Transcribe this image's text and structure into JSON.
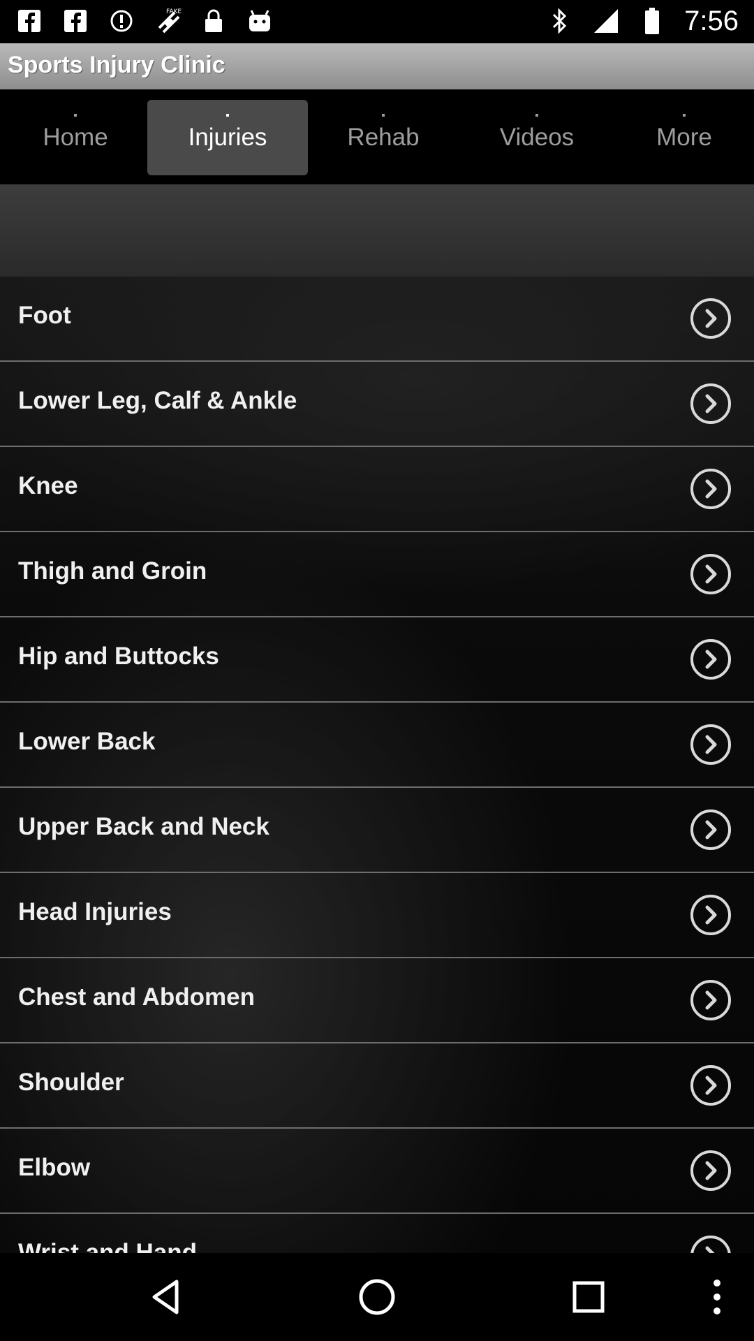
{
  "status_bar": {
    "time": "7:56",
    "icons": [
      "facebook-icon",
      "facebook-icon",
      "alert-circle-icon",
      "fake-gps-icon",
      "lock-icon",
      "android-icon",
      "bluetooth-icon",
      "signal-icon",
      "battery-icon"
    ]
  },
  "app": {
    "title": "Sports Injury Clinic"
  },
  "tabs": [
    {
      "label": "Home",
      "active": false
    },
    {
      "label": "Injuries",
      "active": true
    },
    {
      "label": "Rehab",
      "active": false
    },
    {
      "label": "Videos",
      "active": false
    },
    {
      "label": "More",
      "active": false
    }
  ],
  "injury_list": [
    {
      "label": "Foot"
    },
    {
      "label": "Lower Leg, Calf & Ankle"
    },
    {
      "label": "Knee"
    },
    {
      "label": "Thigh and Groin"
    },
    {
      "label": "Hip and Buttocks"
    },
    {
      "label": "Lower Back"
    },
    {
      "label": "Upper Back and Neck"
    },
    {
      "label": "Head Injuries"
    },
    {
      "label": "Chest and Abdomen"
    },
    {
      "label": "Shoulder"
    },
    {
      "label": "Elbow"
    },
    {
      "label": "Wrist and Hand"
    }
  ],
  "nav_bar": {
    "buttons": [
      "back-icon",
      "home-icon",
      "recents-icon",
      "menu-icon"
    ]
  },
  "colors": {
    "title_bar": "#a3a3a3",
    "active_tab": "#4a4a4a",
    "divider": "#6d6d6d",
    "text": "#f0f0f0"
  }
}
